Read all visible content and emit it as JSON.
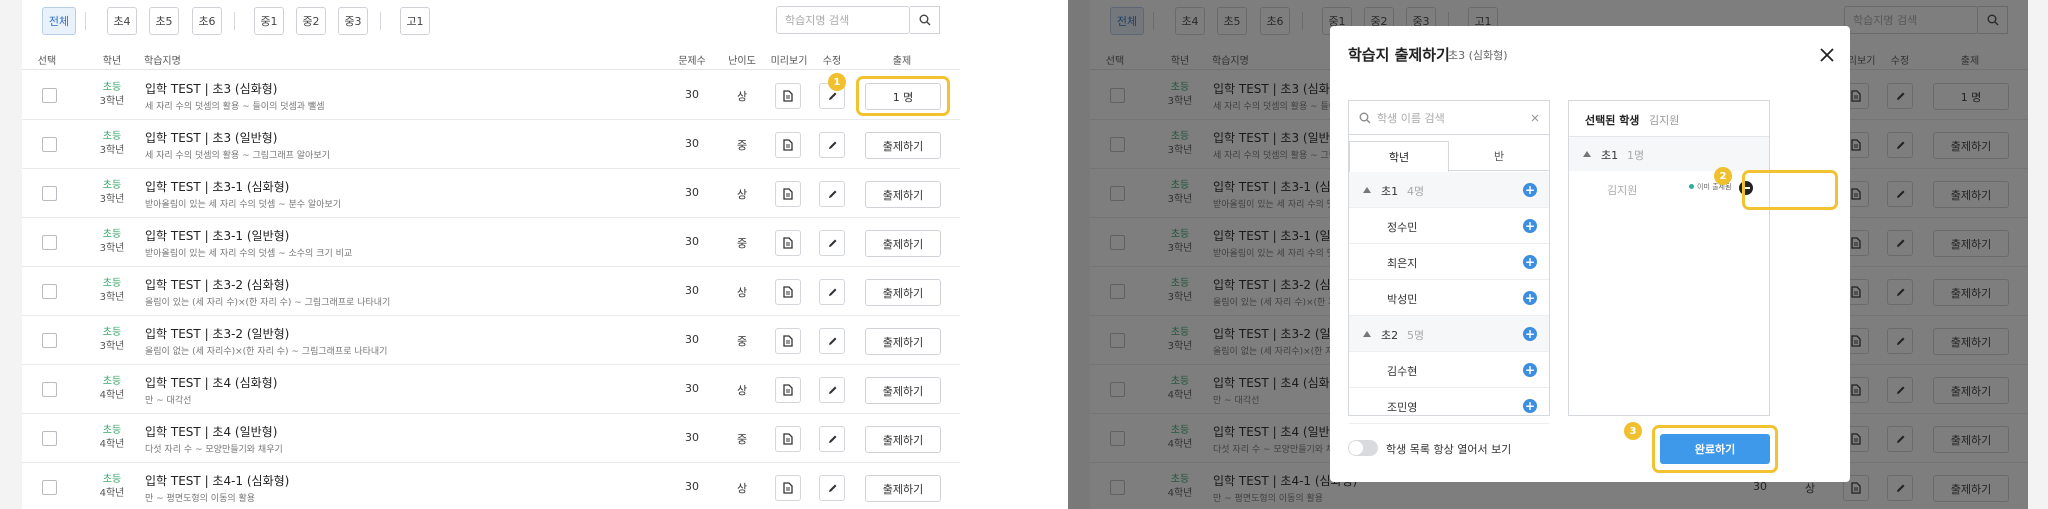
{
  "filters": [
    "전체",
    "초4",
    "초5",
    "초6",
    "중1",
    "중2",
    "중3",
    "고1"
  ],
  "search": {
    "placeholder": "학습지명 검색"
  },
  "columns": [
    "선택",
    "학년",
    "학습지명",
    "문제수",
    "난이도",
    "미리보기",
    "수정",
    "출제"
  ],
  "rows": [
    {
      "school": "초등",
      "grade": "3학년",
      "title": "입학 TEST | 초3 (심화형)",
      "desc": "세 자리 수의 덧셈의 활용 ~ 들이의 덧셈과 뺄셈",
      "count": "30",
      "difficulty": "상",
      "action": "1 명"
    },
    {
      "school": "초등",
      "grade": "3학년",
      "title": "입학 TEST | 초3 (일반형)",
      "desc": "세 자리 수의 덧셈의 활용 ~ 그림그래프 알아보기",
      "count": "30",
      "difficulty": "중",
      "action": "출제하기"
    },
    {
      "school": "초등",
      "grade": "3학년",
      "title": "입학 TEST | 초3-1 (심화형)",
      "desc": "받아올림이 있는 세 자리 수의 덧셈 ~ 분수 알아보기",
      "count": "30",
      "difficulty": "상",
      "action": "출제하기"
    },
    {
      "school": "초등",
      "grade": "3학년",
      "title": "입학 TEST | 초3-1 (일반형)",
      "desc": "받아올림이 있는 세 자리 수의 덧셈 ~ 소수의 크기 비교",
      "count": "30",
      "difficulty": "중",
      "action": "출제하기"
    },
    {
      "school": "초등",
      "grade": "3학년",
      "title": "입학 TEST | 초3-2 (심화형)",
      "desc": "올림이 있는 (세 자리 수)×(한 자리 수) ~ 그림그래프로 나타내기",
      "count": "30",
      "difficulty": "상",
      "action": "출제하기"
    },
    {
      "school": "초등",
      "grade": "3학년",
      "title": "입학 TEST | 초3-2 (일반형)",
      "desc": "올림이 없는 (세 자리수)×(한 자리 수) ~ 그림그래프로 나타내기",
      "count": "30",
      "difficulty": "중",
      "action": "출제하기"
    },
    {
      "school": "초등",
      "grade": "4학년",
      "title": "입학 TEST | 초4 (심화형)",
      "desc": "만 ~ 대각선",
      "count": "30",
      "difficulty": "상",
      "action": "출제하기"
    },
    {
      "school": "초등",
      "grade": "4학년",
      "title": "입학 TEST | 초4 (일반형)",
      "desc": "다섯 자리 수 ~ 모양만들기와 채우기",
      "count": "30",
      "difficulty": "중",
      "action": "출제하기"
    },
    {
      "school": "초등",
      "grade": "4학년",
      "title": "입학 TEST | 초4-1 (심화형)",
      "desc": "만 ~ 평면도형의 이동의 활용",
      "count": "30",
      "difficulty": "상",
      "action": "출제하기"
    }
  ],
  "badges": [
    "1",
    "2",
    "3"
  ],
  "modal": {
    "title": "학습지 출제하기",
    "subtitle": "초3 (심화형)",
    "student_search_placeholder": "학생 이름 검색",
    "tabs": [
      "학년",
      "반"
    ],
    "groups": [
      {
        "name": "초1",
        "count": "4명",
        "students": [
          "정수민",
          "최은지",
          "박성민"
        ]
      },
      {
        "name": "초2",
        "count": "5명",
        "students": [
          "김수현",
          "조민영"
        ]
      }
    ],
    "selected_header": "선택된 학생",
    "selected_header_name": "김지원",
    "selected_group": {
      "name": "초1",
      "count": "1명"
    },
    "selected_student": {
      "name": "김지원",
      "status": "이미 출제됨"
    },
    "toggle_label": "학생 목록 항상 열어서 보기",
    "done_label": "완료하기"
  },
  "colors": {
    "accent": "#3f99ea",
    "highlight": "#f2c230",
    "school": "#3aa76d"
  }
}
